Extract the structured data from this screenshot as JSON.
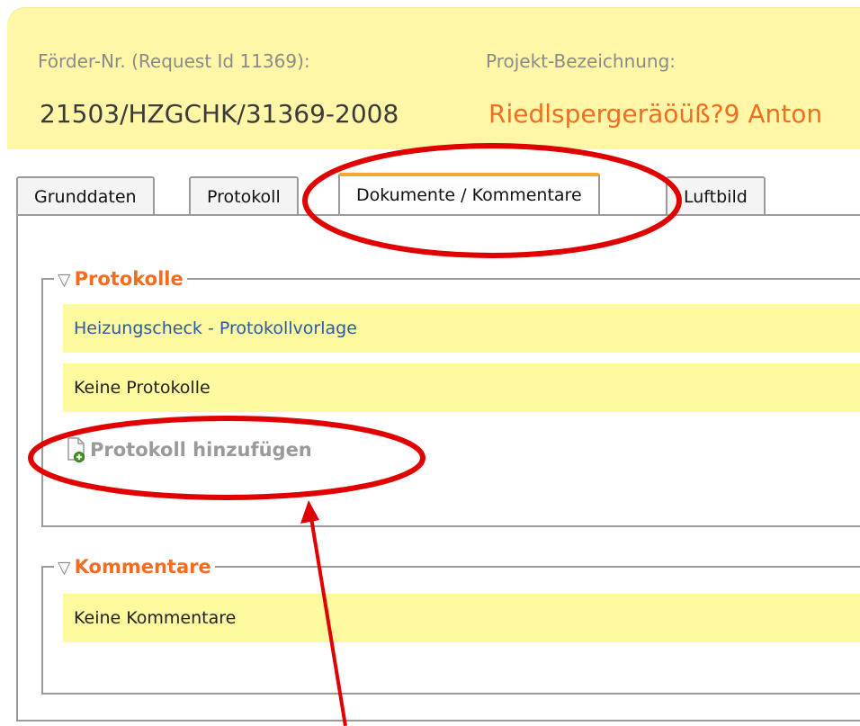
{
  "header": {
    "foerder_label": "Förder-Nr. (Request Id 11369):",
    "foerder_value": "21503/HZGCHK/31369-2008",
    "projekt_label": "Projekt-Bezeichnung:",
    "projekt_value": "Riedlspergeräöüß?9 Anton"
  },
  "tabs": [
    {
      "label": "Grunddaten"
    },
    {
      "label": "Protokoll"
    },
    {
      "label": "Dokumente / Kommentare",
      "active": true
    },
    {
      "label": "Luftbild"
    }
  ],
  "protokolle": {
    "title": "Protokolle",
    "template_link": "Heizungscheck - Protokollvorlage",
    "empty_text": "Keine Protokolle",
    "add_label": "Protokoll hinzufügen"
  },
  "kommentare": {
    "title": "Kommentare",
    "empty_text": "Keine Kommentare"
  },
  "colors": {
    "accent_orange": "#f26d1f",
    "header_bg": "#fff6a8",
    "row_bg": "#fcf99e",
    "annotation_red": "#e10000"
  }
}
